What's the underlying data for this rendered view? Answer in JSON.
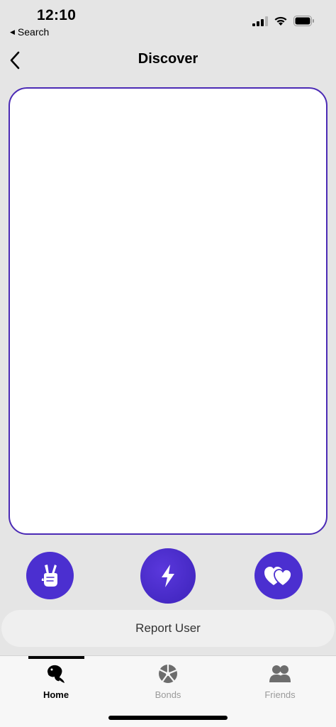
{
  "status_bar": {
    "time": "12:10",
    "back_app_label": "Search",
    "icons": [
      "cellular-signal-icon",
      "wifi-icon",
      "battery-icon"
    ]
  },
  "nav": {
    "title": "Discover",
    "back_icon": "chevron-left-icon"
  },
  "actions": {
    "peace_icon": "peace-hand-icon",
    "bolt_icon": "lightning-bolt-icon",
    "hearts_icon": "two-hearts-icon",
    "accent_color": "#4b2fd0"
  },
  "report": {
    "label": "Report User"
  },
  "tabs": [
    {
      "label": "Home",
      "icon": "home-bird-icon",
      "active": true
    },
    {
      "label": "Bonds",
      "icon": "bonds-pinwheel-icon",
      "active": false
    },
    {
      "label": "Friends",
      "icon": "friends-people-icon",
      "active": false
    }
  ],
  "colors": {
    "background": "#e5e5e5",
    "card_border": "#4b2ab5",
    "inactive_tab": "#9a9a9a"
  }
}
